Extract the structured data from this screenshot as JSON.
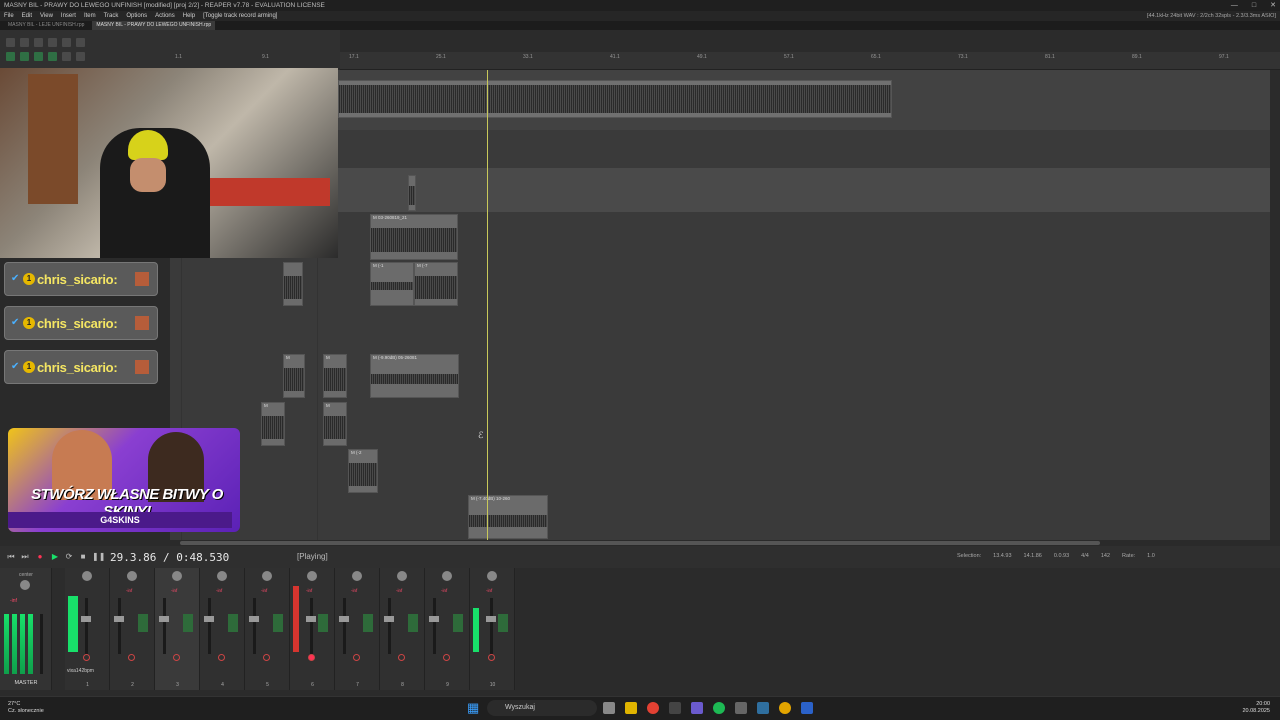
{
  "window": {
    "title": "MASNY BIL - PRAWY DO LEWEGO UNFINISH [modified] [proj 2/2] - REAPER v7.78 - EVALUATION LICENSE"
  },
  "menu": {
    "items": [
      "File",
      "Edit",
      "View",
      "Insert",
      "Item",
      "Track",
      "Options",
      "Actions",
      "Help"
    ],
    "hint": "[Toggle track record arming]",
    "audio_status": "[44.1kHz 24bit WAV : 2/2ch 32spls - 2.3/3.3ms ASIO]"
  },
  "project_tabs": [
    "MASNY BIL - LEJE UNFINISH.rpp",
    "MASNY BIL - PRAWY DO LEWEGO UNFINISH.rpp"
  ],
  "ruler": {
    "marks": [
      "1.1",
      "9.1",
      "17.1",
      "25.1",
      "33.1",
      "41.1",
      "49.1",
      "57.1",
      "65.1",
      "73.1",
      "81.1",
      "89.1",
      "97.1"
    ]
  },
  "items": {
    "labels": [
      "M 03-260819_21",
      "M (-1",
      "M (-7",
      "M",
      "M",
      "M (-9.90dB) 05-26081",
      "M",
      "M",
      "M (-2",
      "M (-7.40dB) 10-260"
    ]
  },
  "chat": {
    "badge": "1",
    "rows": [
      "chris_sicario:",
      "chris_sicario:",
      "chris_sicario:"
    ]
  },
  "ad": {
    "slogan": "STWÓRZ WŁASNE BITWY O SKINY!",
    "brand": "G4SKINS"
  },
  "transport": {
    "time": "29.3.86 / 0:48.530",
    "state": "[Playing]",
    "selection_label": "Selection:",
    "selection_start": "13.4.93",
    "selection_end": "14.1.86",
    "selection_length": "0.0.93",
    "time_sig": "4/4",
    "bpm": "142",
    "rate_label": "Rate:",
    "rate": "1.0"
  },
  "mixer": {
    "master_label": "MASTER",
    "center_label": "center",
    "track_name": "vixa142bpm",
    "vol_label": "-inf",
    "channels": [
      "1",
      "2",
      "3",
      "4",
      "5",
      "6",
      "7",
      "8",
      "9",
      "10"
    ]
  },
  "taskbar": {
    "temp": "27°C",
    "weather": "Cz. słonecznie",
    "search": "Wyszukaj",
    "time": "20:00",
    "date": "20.08.2025"
  },
  "colors": {
    "accent_green": "#18e06a",
    "playcursor": "#c8c85a",
    "chat_name": "#f5e663",
    "rec_red": "#ff3355"
  }
}
